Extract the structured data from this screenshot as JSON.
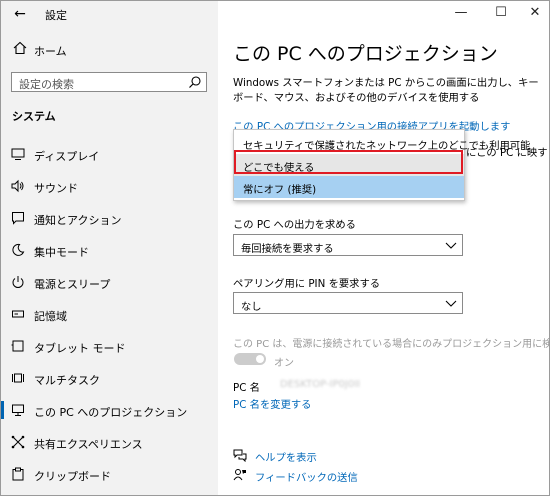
{
  "window": {
    "title": "設定",
    "back": "←",
    "minimize": "—",
    "maximize": "☐",
    "close": "✕"
  },
  "sidebar": {
    "home": "ホーム",
    "search_placeholder": "設定の検索",
    "section": "システム",
    "items": [
      {
        "label": "ディスプレイ",
        "icon": "display-icon"
      },
      {
        "label": "サウンド",
        "icon": "sound-icon"
      },
      {
        "label": "通知とアクション",
        "icon": "notification-icon"
      },
      {
        "label": "集中モード",
        "icon": "moon-icon"
      },
      {
        "label": "電源とスリープ",
        "icon": "power-icon"
      },
      {
        "label": "記憶域",
        "icon": "storage-icon"
      },
      {
        "label": "タブレット モード",
        "icon": "tablet-icon"
      },
      {
        "label": "マルチタスク",
        "icon": "multitask-icon"
      },
      {
        "label": "この PC へのプロジェクション",
        "icon": "projection-icon",
        "active": true
      },
      {
        "label": "共有エクスペリエンス",
        "icon": "share-icon"
      },
      {
        "label": "クリップボード",
        "icon": "clipboard-icon"
      }
    ]
  },
  "main": {
    "title": "この PC へのプロジェクション",
    "description": "Windows スマートフォンまたは PC からこの画面に出力し、キーボード、マウス、およびその他のデバイスを使用する",
    "launch_link": "この PC へのプロジェクション用の接続アプリを起動します",
    "partial_text": "にこの PC に映すこ",
    "dropdown_options": [
      {
        "label": "セキュリティで保護されたネットワーク上のどこでも利用可能",
        "state": "normal"
      },
      {
        "label": "どこでも使える",
        "state": "hover"
      },
      {
        "label": "常にオフ (推奨)",
        "state": "selected"
      }
    ],
    "ask_label": "この PC への出力を求める",
    "ask_value": "毎回接続を要求する",
    "pin_label": "ペアリング用に PIN を要求する",
    "pin_value": "なし",
    "power_text": "この PC は、電源に接続されている場合にのみプロジェクション用に検出できます",
    "toggle_label": "オン",
    "pc_name_label": "PC 名",
    "pc_name_value": "DESKTOP-IP0J0II",
    "rename_link": "PC 名を変更する",
    "help": "ヘルプを表示",
    "feedback": "フィードバックの送信"
  },
  "colors": {
    "accent": "#0067b8",
    "highlight": "#e01b24",
    "selected": "#a6d0f2",
    "sidebar_bg": "#f2f2f2"
  }
}
